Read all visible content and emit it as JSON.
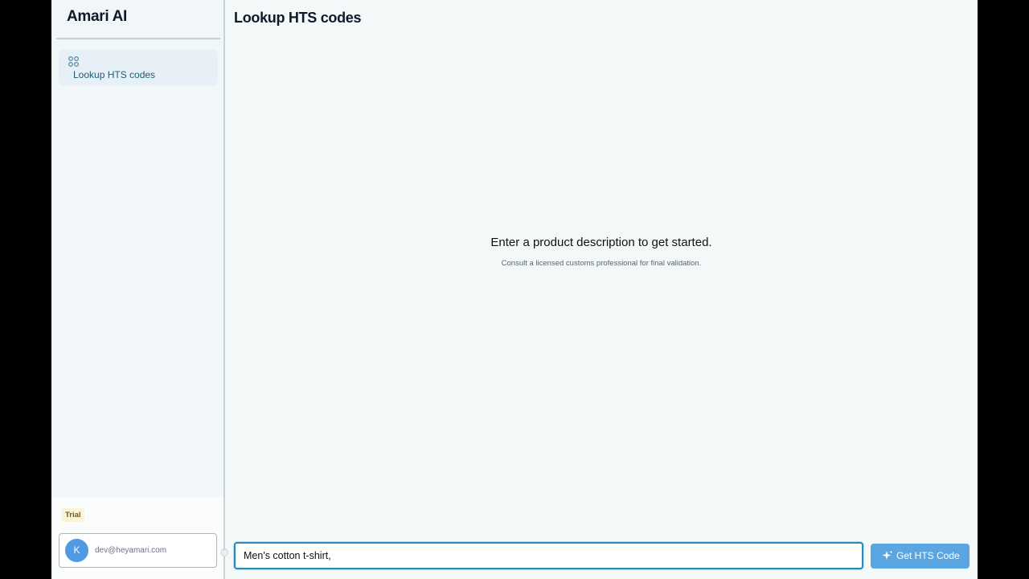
{
  "sidebar": {
    "brand": "Amari AI",
    "nav_items": [
      {
        "label": "Lookup HTS codes",
        "icon": "grid-icon",
        "active": true
      }
    ],
    "plan_badge": "Trial",
    "user": {
      "initial": "K",
      "email": "dev@heyamari.com",
      "avatar_color": "#4f9ae0"
    }
  },
  "main": {
    "title": "Lookup HTS codes",
    "empty_state": {
      "title": "Enter a product description to get started.",
      "subtitle": "Consult a licensed customs professional for final validation."
    },
    "input": {
      "value": "Men's cotton t-shirt,"
    },
    "submit_button": {
      "label": "Get HTS Code",
      "icon": "sparkle-icon",
      "color": "#5aa6e3"
    }
  },
  "colors": {
    "accent": "#2b89b8",
    "background": "#f3f8f9",
    "nav_active_bg": "#e7f0f7"
  }
}
